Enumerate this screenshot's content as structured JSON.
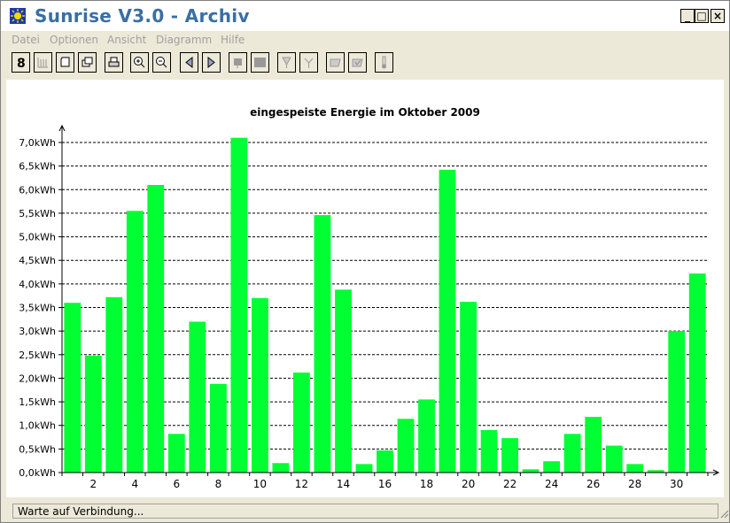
{
  "window": {
    "title": "Sunrise V3.0 - Archiv"
  },
  "controls": {
    "minimize": "_",
    "maximize": "□",
    "close": "×"
  },
  "menu": [
    "Datei",
    "Optionen",
    "Ansicht",
    "Diagramm",
    "Hilfe"
  ],
  "toolbar": [
    "number-eight-icon",
    "chart-grid-icon",
    "scroll-icon",
    "windows-icon",
    "printer-icon",
    "zoom-in-icon",
    "zoom-out-icon",
    "previous-icon",
    "next-icon",
    "square-pin-icon",
    "filled-square-icon",
    "tool-down-icon",
    "tool-pin-icon",
    "folder-down-icon",
    "folder-check-icon",
    "thermometer-icon"
  ],
  "status": {
    "text": "Warte auf Verbindung..."
  },
  "colors": {
    "bar": "#00ff33",
    "title_text": "#3a6ea5"
  },
  "chart_data": {
    "type": "bar",
    "title": "eingespeiste Energie im Oktober 2009",
    "xlabel": "",
    "ylabel": "",
    "ylim": [
      0,
      7.0
    ],
    "grid": true,
    "y_ticks": [
      "0,0kWh",
      "0,5kWh",
      "1,0kWh",
      "1,5kWh",
      "2,0kWh",
      "2,5kWh",
      "3,0kWh",
      "3,5kWh",
      "4,0kWh",
      "4,5kWh",
      "5,0kWh",
      "5,5kWh",
      "6,0kWh",
      "6,5kWh",
      "7,0kWh"
    ],
    "x_ticks": [
      "2",
      "4",
      "6",
      "8",
      "10",
      "12",
      "14",
      "16",
      "18",
      "20",
      "22",
      "24",
      "26",
      "28",
      "30"
    ],
    "categories": [
      "1",
      "2",
      "3",
      "4",
      "5",
      "6",
      "7",
      "8",
      "9",
      "10",
      "11",
      "12",
      "13",
      "14",
      "15",
      "16",
      "17",
      "18",
      "19",
      "20",
      "21",
      "22",
      "23",
      "24",
      "25",
      "26",
      "27",
      "28",
      "29",
      "30",
      "31"
    ],
    "values": [
      3.6,
      2.48,
      3.72,
      5.55,
      6.1,
      0.82,
      3.2,
      1.88,
      7.1,
      3.7,
      0.2,
      2.12,
      5.46,
      3.88,
      0.18,
      0.47,
      1.14,
      1.55,
      6.42,
      3.62,
      0.9,
      0.73,
      0.07,
      0.24,
      0.82,
      1.18,
      0.57,
      0.18,
      0.05,
      3.0,
      4.22
    ]
  }
}
